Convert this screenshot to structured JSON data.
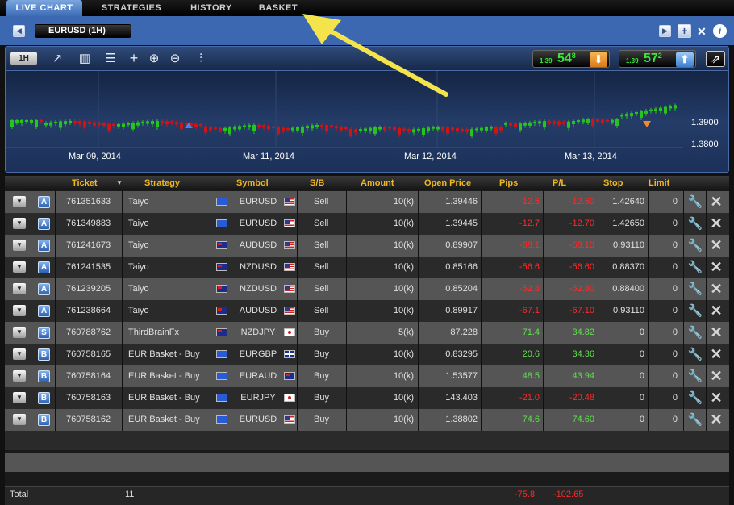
{
  "tabs": [
    "LIVE CHART",
    "STRATEGIES",
    "HISTORY",
    "BASKET"
  ],
  "pair_selector": {
    "label": "EURUSD (1H)"
  },
  "chart": {
    "timeframe": "1H",
    "bid": {
      "prefix": "1.39",
      "big": "54",
      "pip": "8"
    },
    "ask": {
      "prefix": "1.39",
      "big": "57",
      "pip": "2"
    },
    "date_labels": [
      "Mar 09, 2014",
      "Mar 11, 2014",
      "Mar 12, 2014",
      "Mar 13, 2014"
    ],
    "price_labels": [
      "1.3900",
      "1.3800"
    ],
    "up_color": "#27c41d",
    "down_color": "#d01414",
    "arrow_color": "#f4e34a"
  },
  "table": {
    "headers": [
      "Ticket",
      "Strategy",
      "Symbol",
      "S/B",
      "Amount",
      "Open Price",
      "Pips",
      "P/L",
      "Stop",
      "Limit"
    ],
    "rows": [
      {
        "type": "A",
        "ticket": "761351633",
        "strategy": "Taiyo",
        "symbol": "EURUSD",
        "f1": "eu",
        "f2": "us",
        "side": "Sell",
        "amount": "10(k)",
        "open": "1.39446",
        "pips": "-12.6",
        "pl": "-12.60",
        "stop": "1.42640",
        "limit": "0"
      },
      {
        "type": "A",
        "ticket": "761349883",
        "strategy": "Taiyo",
        "symbol": "EURUSD",
        "f1": "eu",
        "f2": "us",
        "side": "Sell",
        "amount": "10(k)",
        "open": "1.39445",
        "pips": "-12.7",
        "pl": "-12.70",
        "stop": "1.42650",
        "limit": "0"
      },
      {
        "type": "A",
        "ticket": "761241673",
        "strategy": "Taiyo",
        "symbol": "AUDUSD",
        "f1": "au",
        "f2": "us",
        "side": "Sell",
        "amount": "10(k)",
        "open": "0.89907",
        "pips": "-68.1",
        "pl": "-68.10",
        "stop": "0.93110",
        "limit": "0"
      },
      {
        "type": "A",
        "ticket": "761241535",
        "strategy": "Taiyo",
        "symbol": "NZDUSD",
        "f1": "nz",
        "f2": "us",
        "side": "Sell",
        "amount": "10(k)",
        "open": "0.85166",
        "pips": "-56.6",
        "pl": "-56.60",
        "stop": "0.88370",
        "limit": "0"
      },
      {
        "type": "A",
        "ticket": "761239205",
        "strategy": "Taiyo",
        "symbol": "NZDUSD",
        "f1": "nz",
        "f2": "us",
        "side": "Sell",
        "amount": "10(k)",
        "open": "0.85204",
        "pips": "-52.8",
        "pl": "-52.80",
        "stop": "0.88400",
        "limit": "0"
      },
      {
        "type": "A",
        "ticket": "761238664",
        "strategy": "Taiyo",
        "symbol": "AUDUSD",
        "f1": "au",
        "f2": "us",
        "side": "Sell",
        "amount": "10(k)",
        "open": "0.89917",
        "pips": "-67.1",
        "pl": "-67.10",
        "stop": "0.93110",
        "limit": "0"
      },
      {
        "type": "S",
        "ticket": "760788762",
        "strategy": "ThirdBrainFx",
        "symbol": "NZDJPY",
        "f1": "nz",
        "f2": "jp",
        "side": "Buy",
        "amount": "5(k)",
        "open": "87.228",
        "pips": "71.4",
        "pl": "34.82",
        "stop": "0",
        "limit": "0"
      },
      {
        "type": "B",
        "ticket": "760758165",
        "strategy": "EUR Basket - Buy",
        "symbol": "EURGBP",
        "f1": "eu",
        "f2": "gb",
        "side": "Buy",
        "amount": "10(k)",
        "open": "0.83295",
        "pips": "20.6",
        "pl": "34.36",
        "stop": "0",
        "limit": "0"
      },
      {
        "type": "B",
        "ticket": "760758164",
        "strategy": "EUR Basket - Buy",
        "symbol": "EURAUD",
        "f1": "eu",
        "f2": "au",
        "side": "Buy",
        "amount": "10(k)",
        "open": "1.53577",
        "pips": "48.5",
        "pl": "43.94",
        "stop": "0",
        "limit": "0"
      },
      {
        "type": "B",
        "ticket": "760758163",
        "strategy": "EUR Basket - Buy",
        "symbol": "EURJPY",
        "f1": "eu",
        "f2": "jp",
        "side": "Buy",
        "amount": "10(k)",
        "open": "143.403",
        "pips": "-21.0",
        "pl": "-20.48",
        "stop": "0",
        "limit": "0"
      },
      {
        "type": "B",
        "ticket": "760758162",
        "strategy": "EUR Basket - Buy",
        "symbol": "EURUSD",
        "f1": "eu",
        "f2": "us",
        "side": "Buy",
        "amount": "10(k)",
        "open": "1.38802",
        "pips": "74.6",
        "pl": "74.60",
        "stop": "0",
        "limit": "0"
      }
    ],
    "footer": {
      "label": "Total",
      "count": "11",
      "pips": "-75.8",
      "pl": "-102.65"
    }
  }
}
